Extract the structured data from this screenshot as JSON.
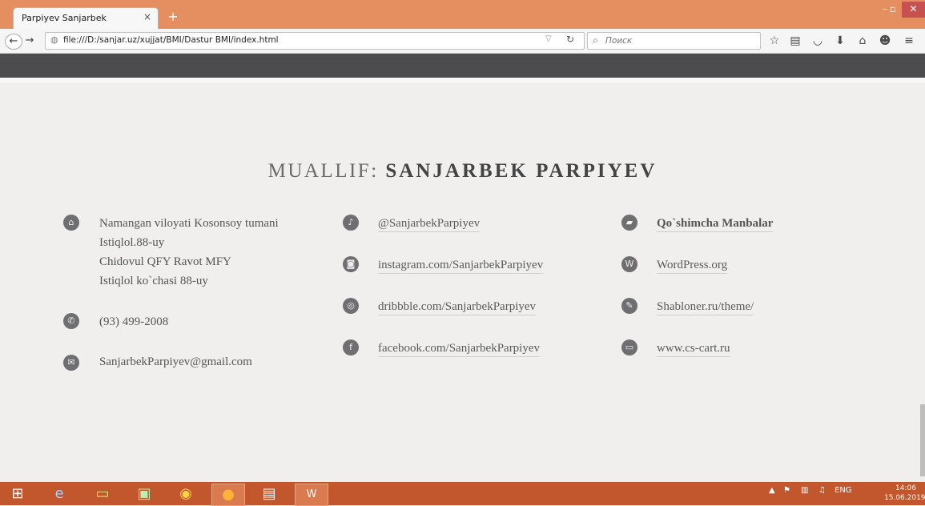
{
  "browser": {
    "tab_title": "Parpiyev Sanjarbek",
    "tab_close": "×",
    "new_tab": "+",
    "url": "file:///D:/sanjar.uz/xujjat/BMI/Dastur BMI/index.html",
    "search_placeholder": "Поиск",
    "toolbar_icons": [
      "star-icon",
      "bookmarks-icon",
      "pocket-icon",
      "download-icon",
      "home-icon",
      "chat-icon",
      "menu-icon"
    ]
  },
  "page": {
    "heading_light": "MUALLIF: ",
    "heading_bold": "SANJARBEK PARPIYEV",
    "contact": {
      "address": [
        "Namangan viloyati Kosonsoy tumani",
        "Istiqlol.88-uy",
        "Chidovul QFY Ravot MFY",
        "Istiqlol ko`chasi 88-uy"
      ],
      "phone": "(93) 499-2008",
      "email": "SanjarbekParpiyev@gmail.com"
    },
    "social": {
      "twitter": "@SanjarbekParpiyev",
      "instagram": "instagram.com/SanjarbekParpiyev",
      "dribbble": "dribbble.com/SanjarbekParpiyev",
      "facebook": "facebook.com/SanjarbekParpiyev"
    },
    "resources": {
      "title": "Qo`shimcha Manbalar",
      "wordpress": "WordPress.org",
      "shabloner": "Shabloner.ru/theme/",
      "cscart": "www.cs-cart.ru"
    }
  },
  "taskbar": {
    "apps": [
      "windows-start-icon",
      "internet-explorer-icon",
      "file-explorer-icon",
      "store-icon",
      "chrome-icon",
      "firefox-icon",
      "save-app-icon",
      "word-icon"
    ],
    "language": "ENG",
    "time": "14:06",
    "date": "15.06.2019"
  }
}
